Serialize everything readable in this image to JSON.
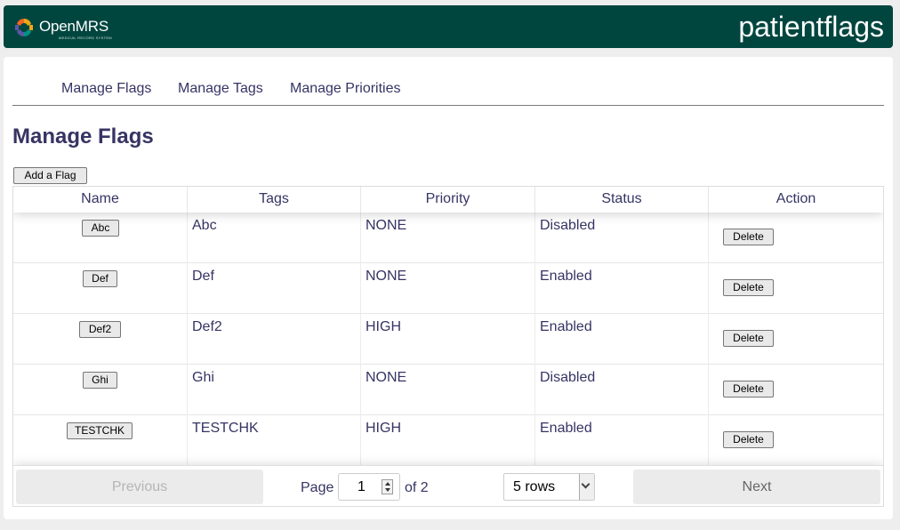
{
  "header": {
    "logo_text": "OpenMRS",
    "logo_subtitle": "MEDICAL RECORD SYSTEM",
    "module_name": "patientflags"
  },
  "nav": {
    "tabs": [
      {
        "label": "Manage Flags"
      },
      {
        "label": "Manage Tags"
      },
      {
        "label": "Manage Priorities"
      }
    ]
  },
  "page": {
    "title": "Manage Flags",
    "add_button": "Add a Flag"
  },
  "table": {
    "columns": [
      "Name",
      "Tags",
      "Priority",
      "Status",
      "Action"
    ],
    "rows": [
      {
        "name": "Abc",
        "tags": "Abc",
        "priority": "NONE",
        "status": "Disabled",
        "action": "Delete"
      },
      {
        "name": "Def",
        "tags": "Def",
        "priority": "NONE",
        "status": "Enabled",
        "action": "Delete"
      },
      {
        "name": "Def2",
        "tags": "Def2",
        "priority": "HIGH",
        "status": "Enabled",
        "action": "Delete"
      },
      {
        "name": "Ghi",
        "tags": "Ghi",
        "priority": "NONE",
        "status": "Disabled",
        "action": "Delete"
      },
      {
        "name": "TESTCHK",
        "tags": "TESTCHK",
        "priority": "HIGH",
        "status": "Enabled",
        "action": "Delete"
      }
    ]
  },
  "pagination": {
    "previous_label": "Previous",
    "next_label": "Next",
    "page_label": "Page",
    "page_value": "1",
    "of_label": "of 2",
    "rows_selected": "5 rows"
  },
  "colors": {
    "header_bg": "#00463f",
    "text_primary": "#363463",
    "page_bg": "#eeeeee"
  }
}
